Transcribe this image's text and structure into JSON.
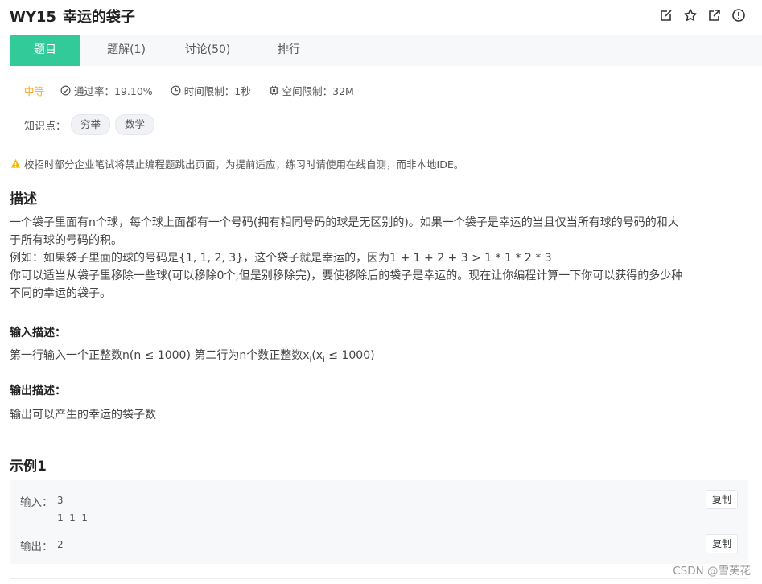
{
  "header": {
    "code": "WY15",
    "title": "幸运的袋子",
    "icons": [
      "edit-icon",
      "star-icon",
      "share-icon",
      "report-icon"
    ]
  },
  "tabs": [
    {
      "label": "题目",
      "active": true
    },
    {
      "label": "题解(1)",
      "active": false
    },
    {
      "label": "讨论(50)",
      "active": false
    },
    {
      "label": "排行",
      "active": false
    }
  ],
  "meta": {
    "difficulty": "中等",
    "pass_rate": "通过率：19.10%",
    "time_limit": "时间限制：1秒",
    "memory_limit": "空间限制：32M"
  },
  "knowledge": {
    "label": "知识点：",
    "tags": [
      "穷举",
      "数学"
    ]
  },
  "warning": "校招时部分企业笔试将禁止编程题跳出页面，为提前适应，练习时请使用在线自测，而非本地IDE。",
  "description": {
    "heading": "描述",
    "line1": "一个袋子里面有n个球，每个球上面都有一个号码(拥有相同号码的球是无区别的)。如果一个袋子是幸运的当且仅当所有球的号码的和大",
    "line2": "于所有球的号码的积。",
    "line3": "例如：如果袋子里面的球的号码是{1, 1, 2, 3}，这个袋子就是幸运的，因为1 + 1 + 2 + 3 > 1 * 1 * 2 * 3",
    "line4": "你可以适当从袋子里移除一些球(可以移除0个,但是别移除完)，要使移除后的袋子是幸运的。现在让你编程计算一下你可以获得的多少种",
    "line5": "不同的幸运的袋子。"
  },
  "input_desc": {
    "heading": "输入描述：",
    "text_a": "第一行输入一个正整数n(n ≤ 1000) 第二行为n个数正整数x",
    "sub1": "i",
    "text_b": "(x",
    "sub2": "i",
    "text_c": " ≤ 1000)"
  },
  "output_desc": {
    "heading": "输出描述：",
    "text": "输出可以产生的幸运的袋子数"
  },
  "example": {
    "heading": "示例1",
    "input_label": "输入：",
    "input_line1": "3",
    "input_line2": "1 1 1",
    "output_label": "输出：",
    "output_value": "2",
    "copy_label": "复制"
  },
  "watermark": "CSDN @雪芙花",
  "colors": {
    "accent": "#32ca99",
    "difficulty": "#f5a623",
    "warning": "#f5b800"
  }
}
